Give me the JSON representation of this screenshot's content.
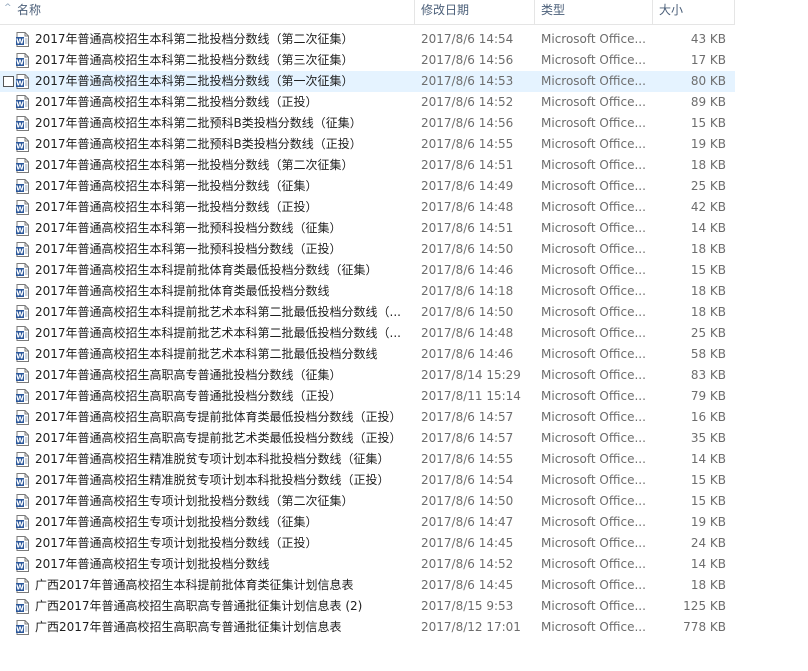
{
  "header": {
    "name_label": "名称",
    "date_label": "修改日期",
    "type_label": "类型",
    "size_label": "大小"
  },
  "colors": {
    "hover_bg": "#e5f3ff",
    "header_text": "#4c607a",
    "doc_icon_blue": "#2b579a"
  },
  "files": [
    {
      "name": "2017年普通高校招生本科第二批投档分数线（第二次征集）",
      "date": "2017/8/6 14:54",
      "type": "Microsoft Office...",
      "size": "43 KB"
    },
    {
      "name": "2017年普通高校招生本科第二批投档分数线（第三次征集）",
      "date": "2017/8/6 14:56",
      "type": "Microsoft Office...",
      "size": "17 KB"
    },
    {
      "name": "2017年普通高校招生本科第二批投档分数线（第一次征集）",
      "date": "2017/8/6 14:53",
      "type": "Microsoft Office...",
      "size": "80 KB",
      "hover": true
    },
    {
      "name": "2017年普通高校招生本科第二批投档分数线（正投）",
      "date": "2017/8/6 14:52",
      "type": "Microsoft Office...",
      "size": "89 KB"
    },
    {
      "name": "2017年普通高校招生本科第二批预科B类投档分数线（征集）",
      "date": "2017/8/6 14:56",
      "type": "Microsoft Office...",
      "size": "15 KB"
    },
    {
      "name": "2017年普通高校招生本科第二批预科B类投档分数线（正投）",
      "date": "2017/8/6 14:55",
      "type": "Microsoft Office...",
      "size": "19 KB"
    },
    {
      "name": "2017年普通高校招生本科第一批投档分数线（第二次征集）",
      "date": "2017/8/6 14:51",
      "type": "Microsoft Office...",
      "size": "18 KB"
    },
    {
      "name": "2017年普通高校招生本科第一批投档分数线（征集）",
      "date": "2017/8/6 14:49",
      "type": "Microsoft Office...",
      "size": "25 KB"
    },
    {
      "name": "2017年普通高校招生本科第一批投档分数线（正投）",
      "date": "2017/8/6 14:48",
      "type": "Microsoft Office...",
      "size": "42 KB"
    },
    {
      "name": "2017年普通高校招生本科第一批预科投档分数线（征集）",
      "date": "2017/8/6 14:51",
      "type": "Microsoft Office...",
      "size": "14 KB"
    },
    {
      "name": "2017年普通高校招生本科第一批预科投档分数线（正投）",
      "date": "2017/8/6 14:50",
      "type": "Microsoft Office...",
      "size": "18 KB"
    },
    {
      "name": "2017年普通高校招生本科提前批体育类最低投档分数线（征集）",
      "date": "2017/8/6 14:46",
      "type": "Microsoft Office...",
      "size": "15 KB"
    },
    {
      "name": "2017年普通高校招生本科提前批体育类最低投档分数线",
      "date": "2017/8/6 14:18",
      "type": "Microsoft Office...",
      "size": "18 KB"
    },
    {
      "name": "2017年普通高校招生本科提前批艺术本科第二批最低投档分数线（...",
      "date": "2017/8/6 14:50",
      "type": "Microsoft Office...",
      "size": "18 KB"
    },
    {
      "name": "2017年普通高校招生本科提前批艺术本科第二批最低投档分数线（...",
      "date": "2017/8/6 14:48",
      "type": "Microsoft Office...",
      "size": "25 KB"
    },
    {
      "name": "2017年普通高校招生本科提前批艺术本科第二批最低投档分数线",
      "date": "2017/8/6 14:46",
      "type": "Microsoft Office...",
      "size": "58 KB"
    },
    {
      "name": "2017年普通高校招生高职高专普通批投档分数线（征集）",
      "date": "2017/8/14 15:29",
      "type": "Microsoft Office...",
      "size": "83 KB"
    },
    {
      "name": "2017年普通高校招生高职高专普通批投档分数线（正投）",
      "date": "2017/8/11 15:14",
      "type": "Microsoft Office...",
      "size": "79 KB"
    },
    {
      "name": "2017年普通高校招生高职高专提前批体育类最低投档分数线（正投）",
      "date": "2017/8/6 14:57",
      "type": "Microsoft Office...",
      "size": "16 KB"
    },
    {
      "name": "2017年普通高校招生高职高专提前批艺术类最低投档分数线（正投）",
      "date": "2017/8/6 14:57",
      "type": "Microsoft Office...",
      "size": "35 KB"
    },
    {
      "name": "2017年普通高校招生精准脱贫专项计划本科批投档分数线（征集）",
      "date": "2017/8/6 14:55",
      "type": "Microsoft Office...",
      "size": "14 KB"
    },
    {
      "name": "2017年普通高校招生精准脱贫专项计划本科批投档分数线（正投）",
      "date": "2017/8/6 14:54",
      "type": "Microsoft Office...",
      "size": "15 KB"
    },
    {
      "name": "2017年普通高校招生专项计划批投档分数线（第二次征集）",
      "date": "2017/8/6 14:50",
      "type": "Microsoft Office...",
      "size": "15 KB"
    },
    {
      "name": "2017年普通高校招生专项计划批投档分数线（征集）",
      "date": "2017/8/6 14:47",
      "type": "Microsoft Office...",
      "size": "19 KB"
    },
    {
      "name": "2017年普通高校招生专项计划批投档分数线（正投）",
      "date": "2017/8/6 14:45",
      "type": "Microsoft Office...",
      "size": "24 KB"
    },
    {
      "name": "2017年普通高校招生专项计划批投档分数线",
      "date": "2017/8/6 14:52",
      "type": "Microsoft Office...",
      "size": "14 KB"
    },
    {
      "name": "广西2017年普通高校招生本科提前批体育类征集计划信息表",
      "date": "2017/8/6 14:45",
      "type": "Microsoft Office...",
      "size": "18 KB"
    },
    {
      "name": "广西2017年普通高校招生高职高专普通批征集计划信息表 (2)",
      "date": "2017/8/15 9:53",
      "type": "Microsoft Office...",
      "size": "125 KB"
    },
    {
      "name": "广西2017年普通高校招生高职高专普通批征集计划信息表",
      "date": "2017/8/12 17:01",
      "type": "Microsoft Office...",
      "size": "778 KB"
    }
  ]
}
